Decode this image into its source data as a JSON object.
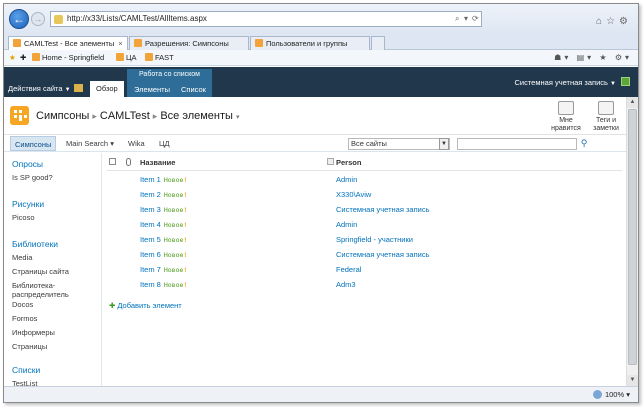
{
  "browser": {
    "url": "http://x33/Lists/CAMLTest/AllItems.aspx",
    "tabs": [
      {
        "label": "CAMLTest - Все элементы",
        "active": true
      },
      {
        "label": "Разрешения: Симпсоны",
        "active": false
      },
      {
        "label": "Пользователи и группы",
        "active": false
      }
    ],
    "favorites": [
      "Home - Springfield",
      "ЦА",
      "FAST"
    ],
    "zoom": "100%"
  },
  "ribbon": {
    "site_actions": "Действия сайта",
    "tab_overview": "Обзор",
    "context_group": "Работа со списком",
    "context_tabs": [
      "Элементы",
      "Список"
    ],
    "user": "Системная учетная запись"
  },
  "header": {
    "site": "Симпсоны",
    "list": "CAMLTest",
    "view": "Все элементы",
    "social": [
      "Мне нравится",
      "Теги и заметки"
    ]
  },
  "topnav": {
    "items": [
      "Симпсоны",
      "Main Search",
      "Wika",
      "ЦД"
    ],
    "search_scope": "Все сайты"
  },
  "quicklaunch": {
    "sections": [
      {
        "heading": "Опросы",
        "items": [
          "Is SP good?"
        ]
      },
      {
        "heading": "Рисунки",
        "items": [
          "Picoso"
        ]
      },
      {
        "heading": "Библиотеки",
        "items": [
          "Media",
          "Страницы сайта",
          "Библиотека-распределитель",
          "Docos",
          "Formos",
          "Информеры",
          "Страницы"
        ]
      },
      {
        "heading": "Списки",
        "items": [
          "TestList"
        ]
      }
    ]
  },
  "list": {
    "columns": [
      "Название",
      "Person"
    ],
    "new_label": "Новое",
    "new_mark": "!",
    "rows": [
      {
        "title": "Item 1",
        "person": "Admin"
      },
      {
        "title": "Item 2",
        "person": "X330\\Aviw"
      },
      {
        "title": "Item 3",
        "person": "Системная учетная запись"
      },
      {
        "title": "Item 4",
        "person": "Admin"
      },
      {
        "title": "Item 5",
        "person": "Springfield - участники"
      },
      {
        "title": "Item 6",
        "person": "Системная учетная запись"
      },
      {
        "title": "Item 7",
        "person": "Federal"
      },
      {
        "title": "Item 8",
        "person": "Adm3"
      }
    ],
    "add_item": "Добавить элемент"
  }
}
